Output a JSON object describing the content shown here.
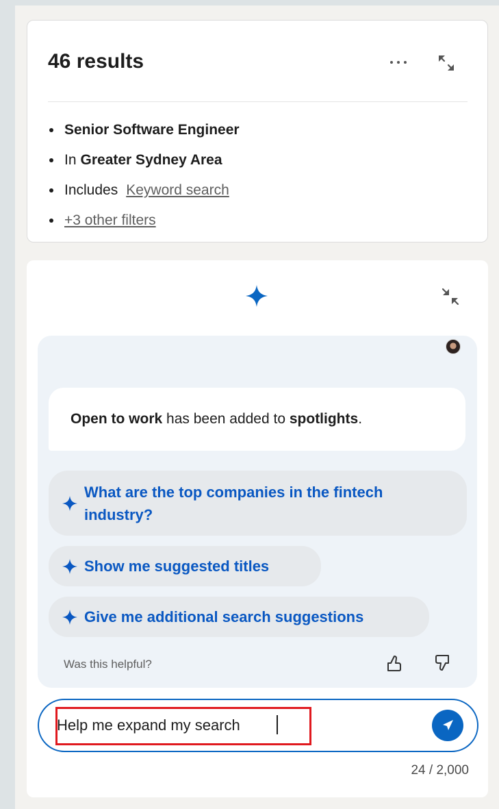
{
  "results": {
    "title": "46 results",
    "filters": {
      "title_filter": "Senior Software Engineer",
      "location_prefix": "In",
      "location": "Greater Sydney Area",
      "includes_prefix": "Includes",
      "includes_link": "Keyword search",
      "other_filters_link": "+3 other filters"
    }
  },
  "assistant": {
    "message": {
      "part1": "Open to work",
      "part2": " has been added to ",
      "part3": "spotlights",
      "part4": "."
    },
    "suggestions": {
      "s1": "What are the top companies in the fintech industry?",
      "s2": "Show me suggested titles",
      "s3": "Give me additional search suggestions"
    },
    "helpful_label": "Was this helpful?",
    "input_value": "Help me expand my search",
    "char_count": "24 / 2,000"
  },
  "icons": {
    "more": "more-horizontal-icon",
    "expand": "expand-icon",
    "collapse": "collapse-icon",
    "sparkle": "sparkle-icon",
    "thumbs_up": "thumbs-up-icon",
    "thumbs_down": "thumbs-down-icon",
    "send": "send-icon"
  },
  "colors": {
    "accent": "#0a66c2",
    "suggestion_text": "#0a58c2",
    "highlight": "#e0191e"
  }
}
